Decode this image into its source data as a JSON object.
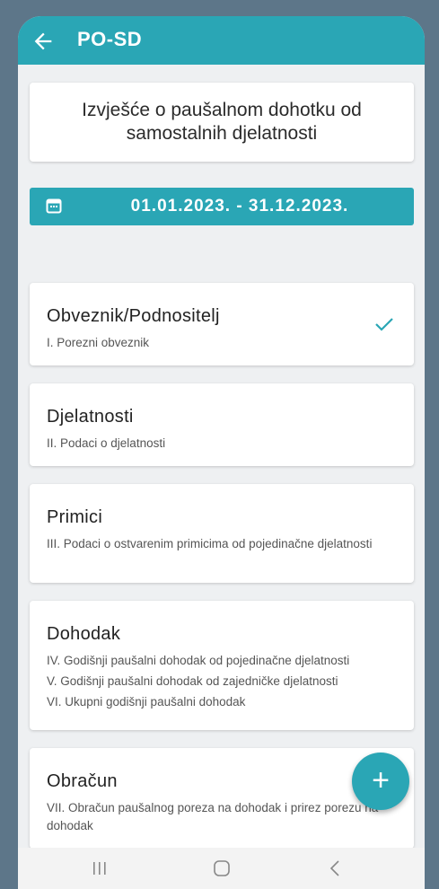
{
  "appbar": {
    "title": "PO-SD",
    "back_icon": "arrow-left-icon"
  },
  "heading": {
    "text": "Izvješće o paušalnom dohotku od samostalnih djelatnosti"
  },
  "period": {
    "text": "01.01.2023. - 31.12.2023.",
    "icon": "calendar-icon"
  },
  "sections": [
    {
      "title": "Obveznik/Podnositelj",
      "lines": [
        "I. Porezni obveznik"
      ],
      "completed": true
    },
    {
      "title": "Djelatnosti",
      "lines": [
        "II. Podaci o djelatnosti"
      ],
      "completed": false
    },
    {
      "title": "Primici",
      "lines": [
        "III. Podaci o ostvarenim primicima od pojedinačne djelatnosti"
      ],
      "completed": false
    },
    {
      "title": "Dohodak",
      "lines": [
        "IV. Godišnji paušalni dohodak od pojedinačne djelatnosti",
        "V. Godišnji paušalni dohodak od zajedničke djelatnosti",
        "VI. Ukupni godišnji paušalni dohodak"
      ],
      "completed": false
    },
    {
      "title": "Obračun",
      "lines": [
        "VII. Obračun paušalnog poreza na dohodak i prirez porezu na dohodak"
      ],
      "completed": false
    }
  ],
  "fab": {
    "label": "+",
    "icon": "plus-icon"
  },
  "navbar": {
    "icons": [
      "recent-apps-icon",
      "home-icon",
      "back-icon"
    ]
  },
  "colors": {
    "primary": "#2aa6b5",
    "background": "#eef0f2",
    "card": "#ffffff"
  }
}
